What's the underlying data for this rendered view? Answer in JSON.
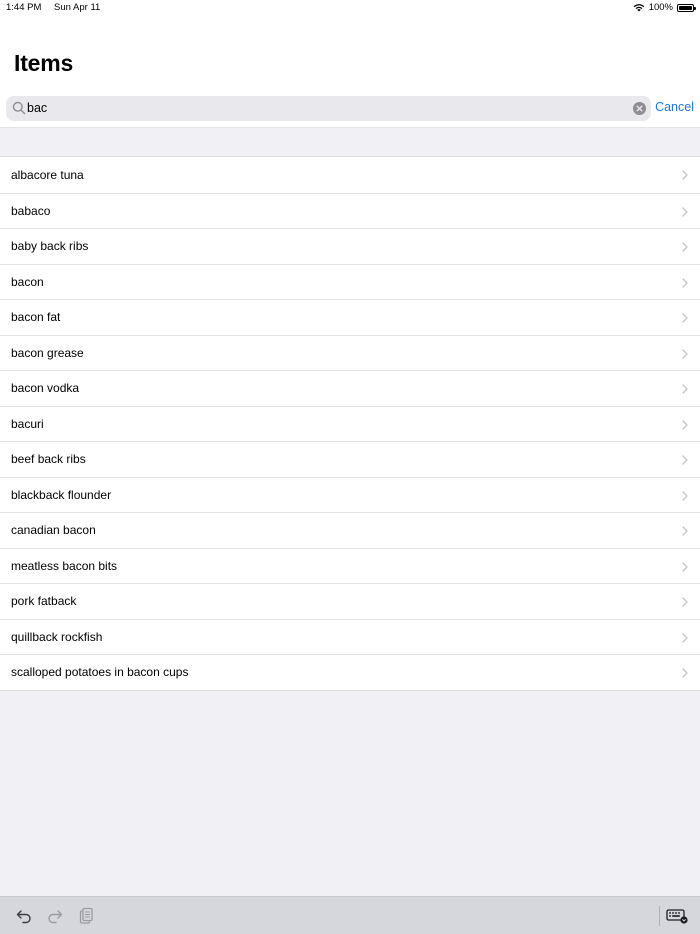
{
  "status_bar": {
    "time": "1:44 PM",
    "date": "Sun Apr 11",
    "battery": "100%",
    "icons": [
      "wifi-icon",
      "battery-icon"
    ]
  },
  "header": {
    "title": "Items"
  },
  "search": {
    "value": "bac",
    "cancel_label": "Cancel",
    "icons": [
      "search-icon",
      "clear-icon"
    ]
  },
  "list": {
    "items": [
      "albacore tuna",
      "babaco",
      "baby back ribs",
      "bacon",
      "bacon fat",
      "bacon grease",
      "bacon vodka",
      "bacuri",
      "beef back ribs",
      "blackback flounder",
      "canadian bacon",
      "meatless bacon bits",
      "pork fatback",
      "quillback rockfish",
      "scalloped potatoes in bacon cups"
    ]
  },
  "toolbar": {
    "icons": [
      "undo-icon",
      "redo-icon",
      "paste-icon",
      "keyboard-dismiss-icon"
    ]
  },
  "colors": {
    "accent": "#1577e8",
    "background": "#f0f0f5",
    "search_field": "#e8e8ed"
  }
}
